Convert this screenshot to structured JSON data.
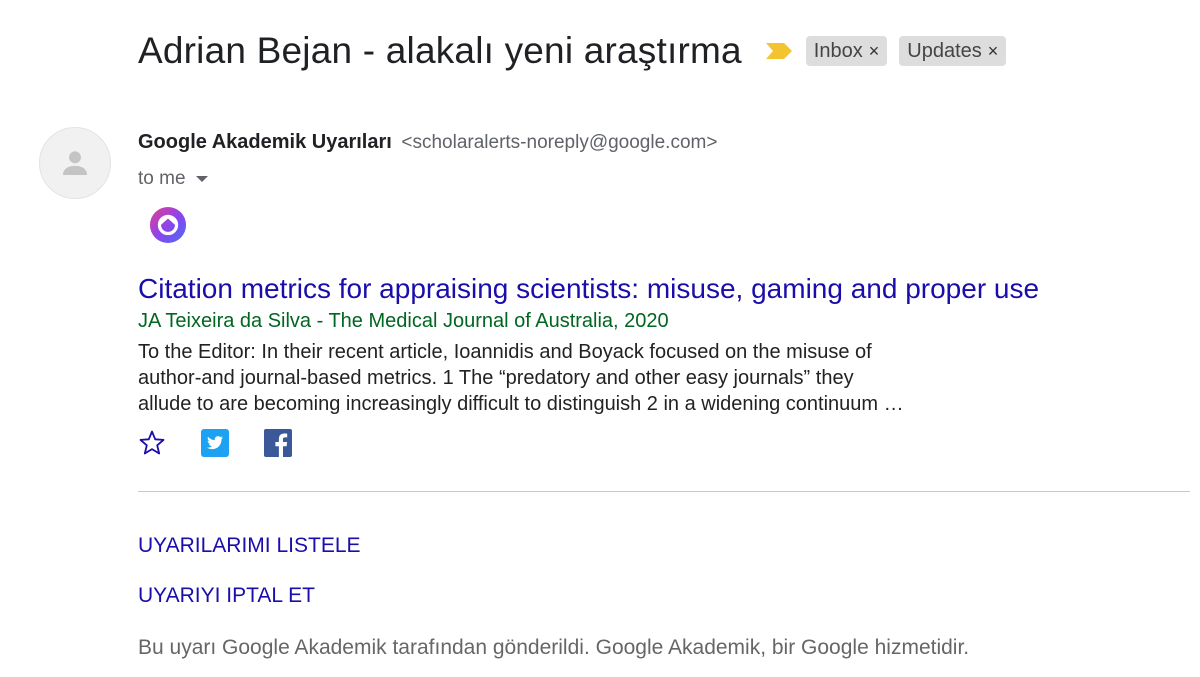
{
  "email": {
    "subject": "Adrian Bejan - alakalı yeni araştırma",
    "labels": [
      {
        "name": "Inbox",
        "remove_glyph": "×"
      },
      {
        "name": "Updates",
        "remove_glyph": "×"
      }
    ],
    "importance_marker_color": "#f4c430",
    "sender": {
      "name": "Google Akademik Uyarıları",
      "address": "<scholaralerts-noreply@google.com>"
    },
    "recipient_label": "to me"
  },
  "article": {
    "title": "Citation metrics for appraising scientists: misuse, gaming and proper use",
    "source": "JA Teixeira da Silva - The Medical Journal of Australia, 2020",
    "snippet_lines": [
      "To the Editor: In their recent article, Ioannidis and Boyack focused on the misuse of",
      "author-and journal-based metrics. 1 The “predatory and other easy journals” they",
      "allude to are becoming increasingly difficult to distinguish 2 in a widening continuum …"
    ]
  },
  "share_icons": [
    "star-icon",
    "twitter-icon",
    "facebook-icon"
  ],
  "footer": {
    "list_alerts": "UYARILARIMI LISTELE",
    "cancel_alert": "UYARIYI IPTAL ET",
    "note": "Bu uyarı Google Akademik tarafından gönderildi. Google Akademik, bir Google hizmetidir."
  },
  "colors": {
    "link": "#1a0dab",
    "source_green": "#006621",
    "twitter_blue": "#1da1f2",
    "facebook_blue": "#3b5998"
  }
}
